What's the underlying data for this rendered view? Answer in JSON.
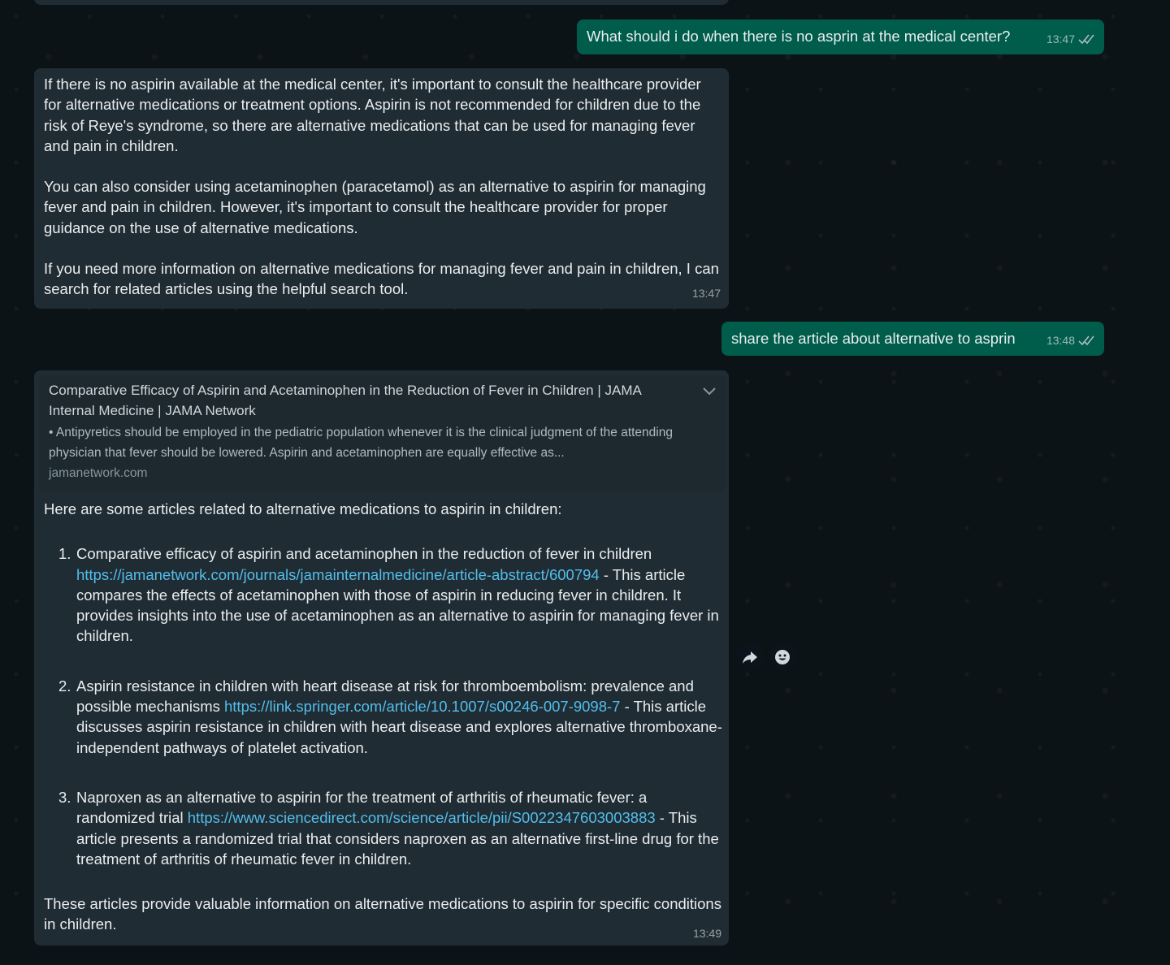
{
  "messages": [
    {
      "direction": "outgoing",
      "text": "What should i do when there is no asprin at the medical center?",
      "time": "13:47",
      "status": "read"
    },
    {
      "direction": "incoming",
      "paragraphs": [
        "If there is no aspirin available at the medical center, it's important to consult the healthcare provider for alternative medications or treatment options. Aspirin is not recommended for children due to the risk of Reye's syndrome, so there are alternative medications that can be used for managing fever and pain in children.",
        "You can also consider using acetaminophen (paracetamol) as an alternative to aspirin for managing fever and pain in children. However, it's important to consult the healthcare provider for proper guidance on the use of alternative medications.",
        "If you need more information on alternative medications for managing fever and pain in children, I can search for related articles using the helpful search tool."
      ],
      "time": "13:47"
    },
    {
      "direction": "outgoing",
      "text": "share the article about alternative to asprin",
      "time": "13:48",
      "status": "read"
    },
    {
      "direction": "incoming",
      "link_preview": {
        "title": "Comparative Efficacy of Aspirin and Acetaminophen in the Reduction of Fever in Children | JAMA Internal Medicine | JAMA Network",
        "description": "• Antipyretics should be employed in the pediatric population whenever it is the clinical judgment of the attending physician that fever should be lowered. Aspirin and acetaminophen are equally effective as...",
        "domain": "jamanetwork.com"
      },
      "intro": "Here are some articles related to alternative medications to aspirin in children:",
      "articles": [
        {
          "number": "1.",
          "title": "Comparative efficacy of aspirin and acetaminophen in the reduction of fever in children",
          "url": "https://jamanetwork.com/journals/jamainternalmedicine/article-abstract/600794",
          "summary": "- This article compares the effects of acetaminophen with those of aspirin in reducing fever in children. It provides insights into the use of acetaminophen as an alternative to aspirin for managing fever in children."
        },
        {
          "number": "2.",
          "title": "Aspirin resistance in children with heart disease at risk for thromboembolism: prevalence and possible mechanisms",
          "url": "https://link.springer.com/article/10.1007/s00246-007-9098-7",
          "summary": "- This article discusses aspirin resistance in children with heart disease and explores alternative thromboxane-independent pathways of platelet activation."
        },
        {
          "number": "3.",
          "title": "Naproxen as an alternative to aspirin for the treatment of arthritis of rheumatic fever: a randomized trial",
          "url": "https://www.sciencedirect.com/science/article/pii/S0022347603003883",
          "summary": "- This article presents a randomized trial that considers naproxen as an alternative first-line drug for the treatment of arthritis of rheumatic fever in children."
        }
      ],
      "outro": "These articles provide valuable information on alternative medications to aspirin for specific conditions in children.",
      "time": "13:49"
    }
  ],
  "hover_actions": [
    "forward-icon",
    "emoji-reaction-icon"
  ],
  "colors": {
    "background": "#0c1317",
    "incoming_bubble": "#202c33",
    "outgoing_bubble": "#005c4b",
    "link": "#53bdeb"
  }
}
